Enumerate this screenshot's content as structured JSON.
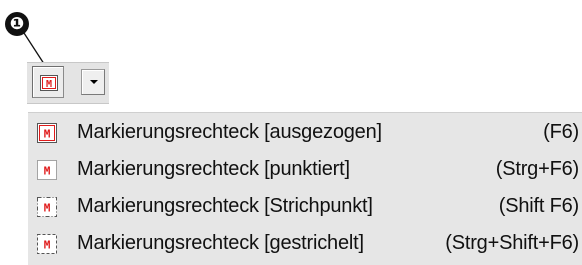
{
  "callout": {
    "number": "❶"
  },
  "toolbar": {
    "button_icon": "marker-rectangle-solid-icon",
    "icon_letter": "M",
    "dropdown_icon": "dropdown-arrow-icon"
  },
  "menu": {
    "items": [
      {
        "label": "Markierungsrechteck [ausgezogen]",
        "shortcut": "(F6)",
        "icon": "marker-rectangle-solid-icon",
        "icon_letter": "M"
      },
      {
        "label": "Markierungsrechteck [punktiert]",
        "shortcut": "(Strg+F6)",
        "icon": "marker-rectangle-dotted-icon",
        "icon_letter": "M"
      },
      {
        "label": "Markierungsrechteck [Strichpunkt]",
        "shortcut": "(Shift F6)",
        "icon": "marker-rectangle-dashdot-icon",
        "icon_letter": "M"
      },
      {
        "label": "Markierungsrechteck [gestrichelt]",
        "shortcut": "(Strg+Shift+F6)",
        "icon": "marker-rectangle-dashed-icon",
        "icon_letter": "M"
      }
    ]
  },
  "colors": {
    "marker_red": "#e01b1b",
    "frame_border": "#555555",
    "menu_background": "#e6e6e6",
    "toolbar_background": "#e4e4e4"
  }
}
